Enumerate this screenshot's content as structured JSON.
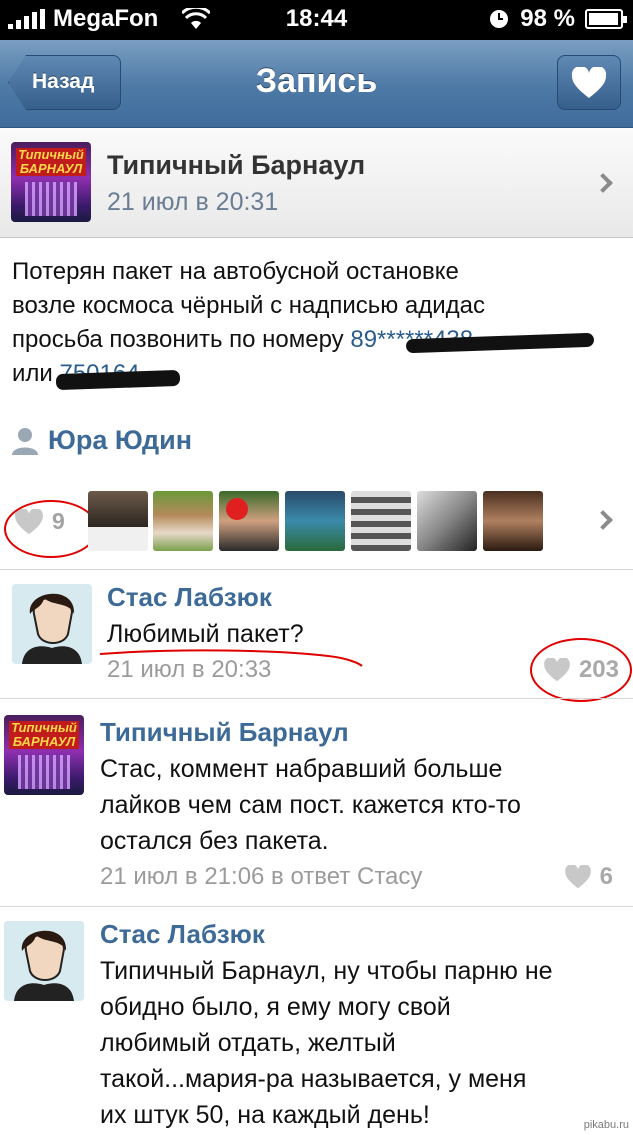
{
  "status_bar": {
    "carrier": "MegaFon",
    "time": "18:44",
    "battery": "98 %"
  },
  "nav": {
    "back_label": "Назад",
    "title": "Запись"
  },
  "post": {
    "group_name": "Типичный Барнаул",
    "group_logo_text": "Типичный БАРНАУЛ",
    "date": "21 июл в 20:31",
    "text_line1": "Потерян пакет на автобусной остановке",
    "text_line2": "возле космоса чёрный с надписью адидас",
    "text_line3_prefix": "просьба позвонить по номеру ",
    "text_line3_phone": "89******438",
    "text_line4_prefix": "или ",
    "text_line4_phone": "750164",
    "author": "Юра Юдин",
    "likes": "9"
  },
  "comments": [
    {
      "name": "Стас Лабзюк",
      "text": "Любимый пакет?",
      "date": "21 июл в 20:33",
      "likes": "203"
    },
    {
      "name": "Типичный Барнаул",
      "text_lines": [
        "Стас, коммент набравший больше",
        "лайков чем сам пост. кажется кто-то",
        "остался без пакета."
      ],
      "date": "21 июл в 21:06 в ответ Стасу",
      "likes": "6"
    },
    {
      "name": "Стас Лабзюк",
      "text_lines": [
        "Типичный Барнаул, ну чтобы парню не",
        "обидно было, я ему могу свой",
        "любимый отдать, желтый",
        "такой...мария-ра называется, у меня",
        "их штук 50, на каждый день!"
      ]
    }
  ],
  "watermark": "pikabu.ru",
  "colors": {
    "nav_top": "#7a9ec2",
    "nav_bottom": "#3f6c9b",
    "link": "#3d6a97",
    "meta": "#9b9b9b",
    "annotation_red": "#e00000"
  }
}
